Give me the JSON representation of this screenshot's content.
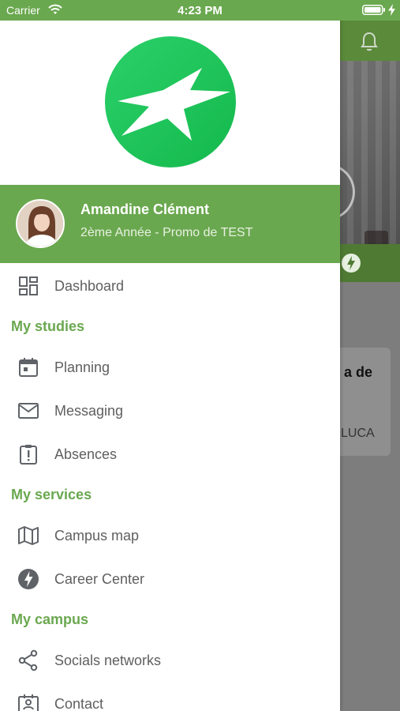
{
  "status_bar": {
    "carrier": "Carrier",
    "time": "4:23 PM"
  },
  "background": {
    "card_title": "a de",
    "card_sub": "LUCA"
  },
  "profile": {
    "name": "Amandine Clément",
    "subtitle": "2ème Année - Promo de TEST"
  },
  "menu": {
    "dashboard": "Dashboard",
    "section_studies": "My studies",
    "planning": "Planning",
    "messaging": "Messaging",
    "absences": "Absences",
    "section_services": "My services",
    "campus_map": "Campus map",
    "career_center": "Career Center",
    "section_campus": "My campus",
    "socials": "Socials networks",
    "contact": "Contact"
  },
  "colors": {
    "accent_green": "#6aa84f",
    "logo_green": "#1ec95a",
    "menu_text": "#5f5f5f",
    "icon_gray": "#5f6368"
  },
  "icons": {
    "dashboard": "dashboard-icon",
    "planning": "calendar-icon",
    "messaging": "mail-icon",
    "absences": "alert-clipboard-icon",
    "campus_map": "map-icon",
    "career_center": "career-bolt-icon",
    "socials": "share-icon",
    "contact": "contact-card-icon"
  }
}
